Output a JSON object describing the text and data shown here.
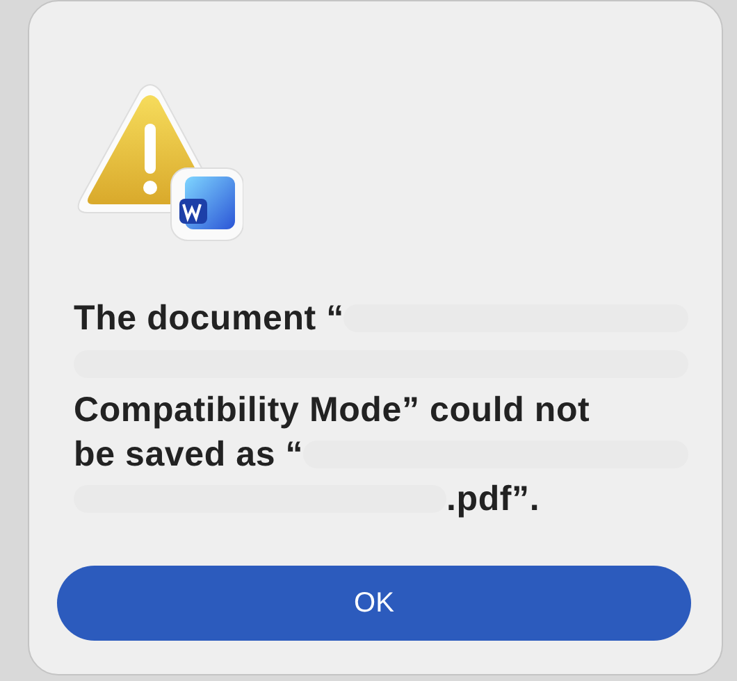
{
  "alert": {
    "message_lines": [
      [
        {
          "kind": "text",
          "text": "The document “"
        },
        {
          "kind": "redacted"
        }
      ],
      [
        {
          "kind": "redacted"
        }
      ],
      [
        {
          "kind": "text",
          "text": "Compatibility Mode” could not"
        }
      ],
      [
        {
          "kind": "text",
          "text": "be saved as “"
        },
        {
          "kind": "redacted"
        }
      ],
      [
        {
          "kind": "redacted"
        },
        {
          "kind": "text",
          "text": ".pdf”."
        }
      ]
    ],
    "buttons": [
      {
        "label": "OK",
        "default": true
      }
    ]
  }
}
